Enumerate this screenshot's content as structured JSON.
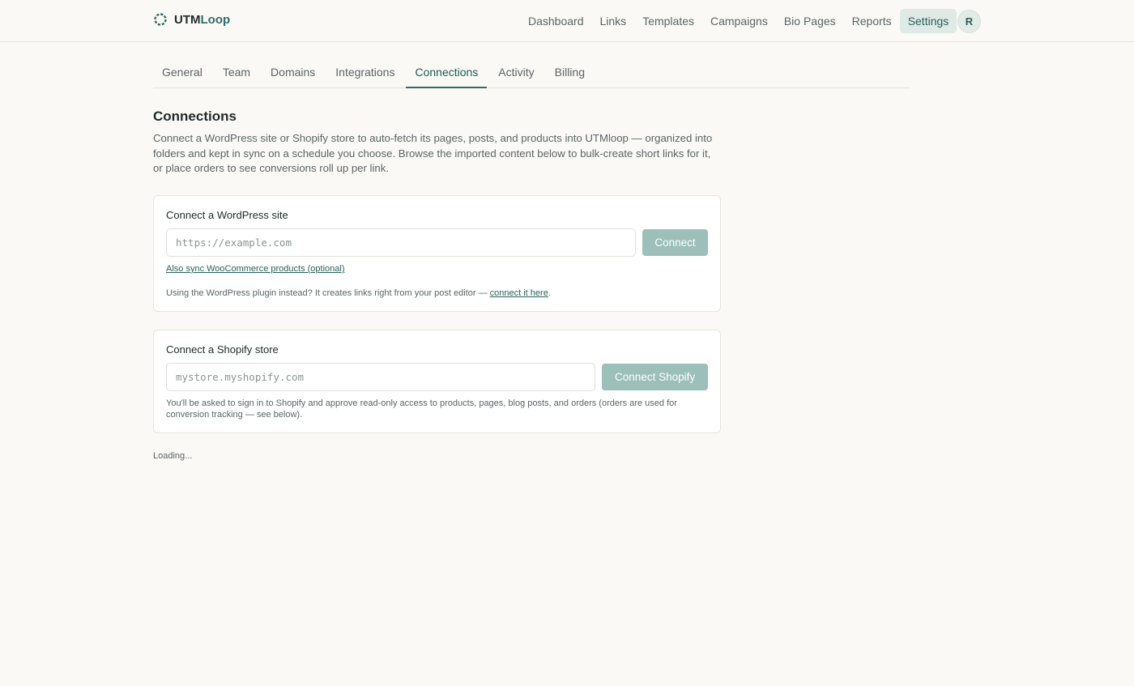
{
  "brand": {
    "name_part1": "UTM",
    "name_part2": "Loop"
  },
  "nav": {
    "items": [
      {
        "label": "Dashboard"
      },
      {
        "label": "Links"
      },
      {
        "label": "Templates"
      },
      {
        "label": "Campaigns"
      },
      {
        "label": "Bio Pages"
      },
      {
        "label": "Reports"
      },
      {
        "label": "Settings",
        "active": true
      }
    ],
    "avatar_initial": "R"
  },
  "tabs": [
    {
      "label": "General"
    },
    {
      "label": "Team"
    },
    {
      "label": "Domains"
    },
    {
      "label": "Integrations"
    },
    {
      "label": "Connections",
      "active": true
    },
    {
      "label": "Activity"
    },
    {
      "label": "Billing"
    }
  ],
  "page": {
    "title": "Connections",
    "intro": "Connect a WordPress site or Shopify store to auto-fetch its pages, posts, and products into UTMloop — organized into folders and kept in sync on a schedule you choose. Browse the imported content below to bulk-create short links for it, or place orders to see conversions roll up per link."
  },
  "wordpress": {
    "title": "Connect a WordPress site",
    "placeholder": "https://example.com",
    "button": "Connect",
    "woo_link": "Also sync WooCommerce products (optional)",
    "note_prefix": "Using the WordPress plugin instead? It creates links right from your post editor — ",
    "note_link": "connect it here",
    "note_suffix": "."
  },
  "shopify": {
    "title": "Connect a Shopify store",
    "placeholder": "mystore.myshopify.com",
    "button": "Connect Shopify",
    "note": "You'll be asked to sign in to Shopify and approve read-only access to products, pages, blog posts, and orders (orders are used for conversion tracking — see below)."
  },
  "loading": "Loading..."
}
